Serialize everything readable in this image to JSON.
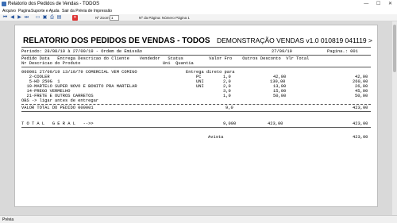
{
  "window": {
    "title": "Relatorio dos Pedidos de Vendas - TODOS",
    "controls": "— ☐ ✕"
  },
  "menu": [
    "Arquivo",
    "Pagina",
    "Suporte e Ajuda",
    "Sair da Prévia de Impressão"
  ],
  "toolbar": {
    "zoom_label": "Nº Zoom",
    "zoom_value": "1",
    "page_label": "Nº da Página: Número Página 1"
  },
  "report": {
    "title": "RELATORIO DOS PEDIDOS DE VENDAS - TODOS",
    "demo": "DEMONSTRAÇÃO VENDAS v1.0 010819 041119 >",
    "period": "Periodo: 28/08/19 à 27/09/19 - Ordem de Emissão",
    "date": "27/09/19",
    "page": "Pagina.: 001",
    "header1": "Pedido Data   Entrega Descricao do Cliente    Vendedor   Status          Valor Fro    Outros Desconto  Vlr Total",
    "header2": "Nr Descricao do Produto                                Uni  Quantia",
    "order_line": "000001 27/09/19 13/10/79 COMERCIAL VEM COMIGO                   Entrega direto para",
    "items": [
      {
        "desc": "   2-COOLER",
        "uni": "PC",
        "qty": "1,0",
        "price": "42,00",
        "total": "42,00"
      },
      {
        "desc": "   5-HD 250G  1",
        "uni": "UNI",
        "qty": "2,0",
        "price": "130,00",
        "total": "260,00"
      },
      {
        "desc": "  19-MARTELO SUPER NOVO E BONITO PRA MARTELAR",
        "uni": "UNI",
        "qty": "2,0",
        "price": "13,00",
        "total": "26,00"
      },
      {
        "desc": "  14-PREGO VERMELHO",
        "uni": "",
        "qty": "3,0",
        "price": "15,00",
        "total": "45,00"
      },
      {
        "desc": "  21-FRETE E OUTROS CARRETOS",
        "uni": "",
        "qty": "1,0",
        "price": "50,00",
        "total": "50,00"
      }
    ],
    "obs": "OBS -> ligar antes de entregar",
    "order_total_label": "VALOR TOTAL DO PEDIDO 000001",
    "order_total_qty": "9,0",
    "order_total_value": "423,00",
    "grand_label": "T O T A L   G E R A L   -->>",
    "grand_qty": "9,000",
    "grand_value": "423,00",
    "grand_total": "423,00",
    "avista_label": "Avista",
    "avista_value": "423,00"
  },
  "status": "Prévia"
}
